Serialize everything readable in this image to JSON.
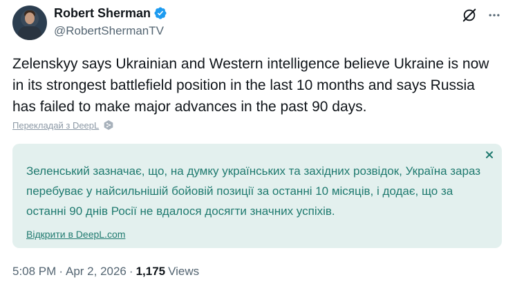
{
  "author": {
    "display_name": "Robert Sherman",
    "handle": "@RobertShermanTV",
    "verified": true
  },
  "tweet": {
    "text": "Zelenskyy says Ukrainian and Western intelligence believe Ukraine is now in its strongest battlefield position in the last 10 months and says Russia has failed to make major advances in the past 90 days."
  },
  "translate": {
    "link_label": "Перекладай з DeepL"
  },
  "translation": {
    "text": "Зеленський зазначає, що, на думку українських та західних розвідок, Україна зараз перебуває у найсильнішій бойовій позиції за останні 10 місяців, і додає, що за останні 90 днів Росії не вдалося досягти значних успіхів.",
    "open_label": "Відкрити в DeepL.com"
  },
  "meta": {
    "time": "5:08 PM",
    "sep1": "·",
    "date": "Apr 2, 2026",
    "sep2": "·",
    "views_count": "1,175",
    "views_label": "Views"
  },
  "colors": {
    "verified_blue": "#1d9bf0",
    "translation_bg": "#e3f0ee",
    "translation_text": "#1f7a6f",
    "secondary_text": "#536471"
  },
  "icons": {
    "verified": "verified-badge-icon",
    "grok": "grok-icon",
    "more": "more-icon",
    "deepl": "deepl-icon",
    "close": "close-icon"
  }
}
